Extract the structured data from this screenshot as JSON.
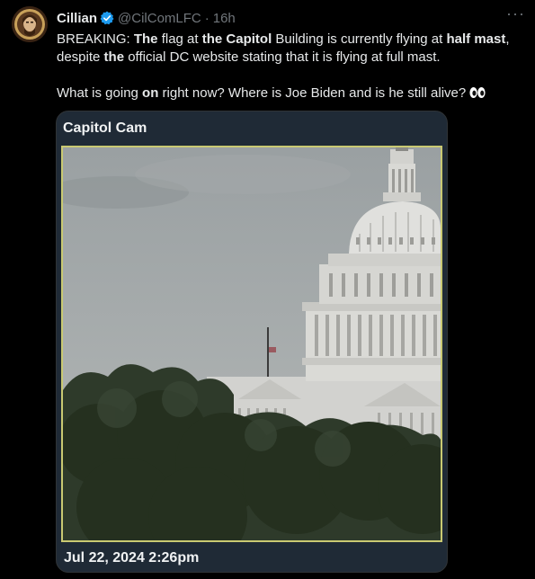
{
  "author": {
    "name": "Cillian",
    "handle": "@CilComLFC",
    "separator": "·",
    "time": "16h"
  },
  "icons": {
    "avatar": "avatar-image",
    "verified": "verified-badge-icon",
    "more": "more-options-icon",
    "eyes": "eyes-emoji-icon"
  },
  "colors": {
    "verified": "#1d9bf0",
    "frame_border": "#c9c972",
    "card_bg": "#1f2a36"
  },
  "tweet": {
    "line1": {
      "t1": "BREAKING: ",
      "b1": "The",
      "t2": " flag at ",
      "b2": "the Capitol",
      "t3": " Building is currently flying at ",
      "b3": "half mast",
      "t4": ","
    },
    "line2": {
      "t1": "despite ",
      "b1": "the",
      "t2": " official DC website stating that it is flying at full mast."
    },
    "line3": {
      "t1": "What is going ",
      "b1": "on",
      "t2": " right now? Where is Joe Biden and is he still alive? "
    }
  },
  "card": {
    "title": "Capitol Cam",
    "date": "Jul 22, 2024 2:26pm"
  }
}
